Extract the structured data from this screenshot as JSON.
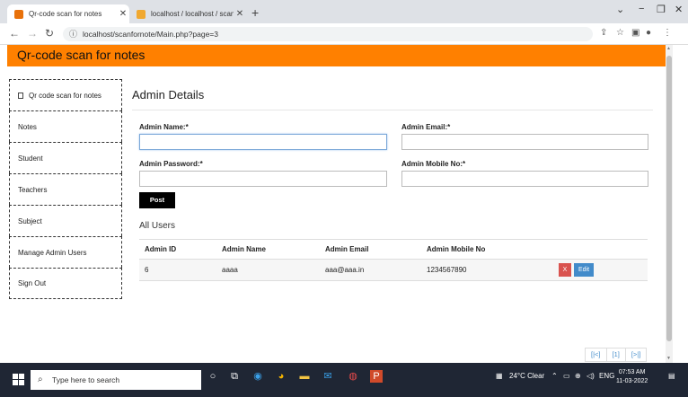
{
  "browser": {
    "tabs": [
      {
        "title": "Qr-code scan for notes",
        "active": true
      },
      {
        "title": "localhost / localhost / scanfornc",
        "active": false
      }
    ],
    "new_tab": "+",
    "url": "localhost/scanfornote/Main.php?page=3",
    "window_controls": {
      "minimize": "−",
      "maximize": "❐",
      "close": "✕"
    }
  },
  "site": {
    "header_title": "Qr-code scan for notes"
  },
  "sidebar": {
    "items": [
      {
        "label": "Qr code scan for notes"
      },
      {
        "label": "Notes"
      },
      {
        "label": "Student"
      },
      {
        "label": "Teachers"
      },
      {
        "label": "Subject"
      },
      {
        "label": "Manage Admin Users"
      },
      {
        "label": "Sign Out"
      }
    ]
  },
  "form": {
    "title": "Admin Details",
    "admin_name_label": "Admin Name:*",
    "admin_email_label": "Admin Email:*",
    "admin_password_label": "Admin Password:*",
    "admin_mobile_label": "Admin Mobile No:*",
    "admin_name_value": "",
    "admin_email_value": "",
    "admin_password_value": "",
    "admin_mobile_value": "",
    "post_label": "Post"
  },
  "users": {
    "title": "All Users",
    "columns": [
      "Admin ID",
      "Admin Name",
      "Admin Email",
      "Admin Mobile No",
      ""
    ],
    "rows": [
      {
        "id": "6",
        "name": "aaaa",
        "email": "aaa@aaa.in",
        "mobile": "1234567890",
        "delete_label": "X",
        "edit_label": "Edit"
      }
    ]
  },
  "pagination": {
    "first": "[|<]",
    "current": "[1]",
    "last": "[>|]"
  },
  "taskbar": {
    "search_placeholder": "Type here to search",
    "weather": "24°C  Clear",
    "language": "ENG",
    "time": "07:53 AM",
    "date": "11-03-2022"
  },
  "colors": {
    "header": "#ff8000",
    "delete": "#d9534f",
    "edit": "#428bca"
  }
}
